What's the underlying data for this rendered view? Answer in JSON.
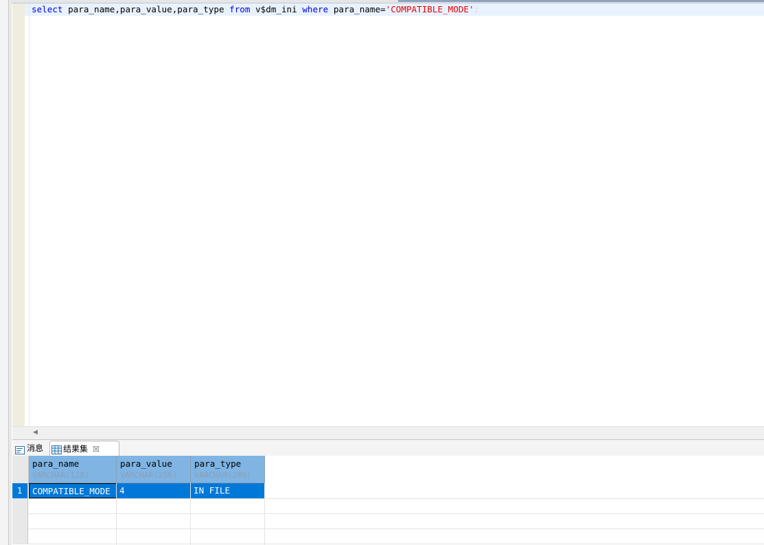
{
  "editor": {
    "sql": {
      "kw_select": "select",
      "cols": " para_name,para_value,para_type ",
      "kw_from": "from",
      "table": " v$dm_ini ",
      "kw_where": "where",
      "cond": " para_name=",
      "literal": "'COMPATIBLE_MODE'",
      "end": ";"
    }
  },
  "result_tabs": {
    "messages_label": "消息",
    "resultset_label": "结果集",
    "close_glyph": "☒"
  },
  "grid": {
    "columns": [
      {
        "name": "para_name",
        "type": "VARCHAR(128)"
      },
      {
        "name": "para_value",
        "type": "VARCHAR(256)"
      },
      {
        "name": "para_type",
        "type": "VARCHAR(200)"
      }
    ],
    "rows": [
      {
        "num": "1",
        "cells": [
          "COMPATIBLE_MODE",
          "4",
          "IN FILE"
        ]
      }
    ]
  },
  "colors": {
    "keyword": "#0000e6",
    "string": "#e60000",
    "header_bg": "#7fb4e3",
    "selection": "#0078d7"
  }
}
